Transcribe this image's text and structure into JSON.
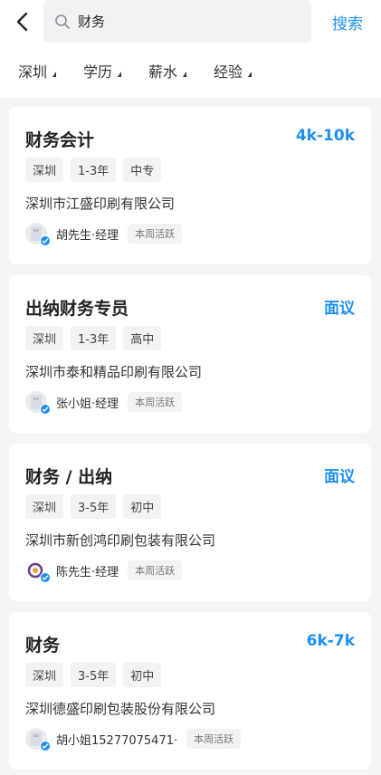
{
  "header": {
    "search_value": "财务",
    "search_button": "搜索"
  },
  "filters": [
    {
      "label": "深圳"
    },
    {
      "label": "学历"
    },
    {
      "label": "薪水"
    },
    {
      "label": "经验"
    }
  ],
  "jobs": [
    {
      "title": "财务会计",
      "salary": "4k-10k",
      "tags": [
        "深圳",
        "1-3年",
        "中专"
      ],
      "company": "深圳市江盛印刷有限公司",
      "recruiter": "胡先生·经理",
      "activity": "本周活跃"
    },
    {
      "title": "出纳财务专员",
      "salary": "面议",
      "tags": [
        "深圳",
        "1-3年",
        "高中"
      ],
      "company": "深圳市泰和精品印刷有限公司",
      "recruiter": "张小姐·经理",
      "activity": "本周活跃"
    },
    {
      "title": "财务 / 出纳",
      "salary": "面议",
      "tags": [
        "深圳",
        "3-5年",
        "初中"
      ],
      "company": "深圳市新创鸿印刷包装有限公司",
      "recruiter": "陈先生·经理",
      "activity": "本周活跃"
    },
    {
      "title": "财务",
      "salary": "6k-7k",
      "tags": [
        "深圳",
        "3-5年",
        "初中"
      ],
      "company": "深圳德盛印刷包装股份有限公司",
      "recruiter": "胡小姐15277075471·",
      "activity": "本周活跃"
    }
  ],
  "colors": {
    "accent": "#1e8ff2",
    "background": "#f4f5f7"
  },
  "icons": {
    "back": "chevron-left-icon",
    "search": "search-icon",
    "verified": "check-badge-icon"
  }
}
